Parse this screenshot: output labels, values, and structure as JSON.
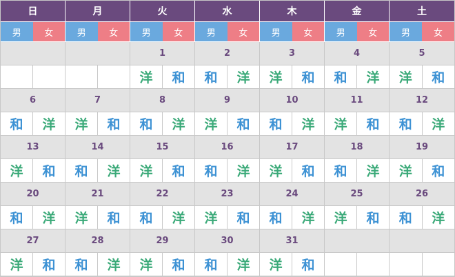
{
  "colors": {
    "header_bg": "#6a4a7e",
    "male": "#6aa9de",
    "female": "#ee7e86",
    "date_bg": "#e3e3e3",
    "date_text": "#6a4a7e",
    "wa": "#3d92d4",
    "yo": "#3aa978"
  },
  "weekdays": [
    "日",
    "月",
    "火",
    "水",
    "木",
    "金",
    "土"
  ],
  "gender_labels": {
    "male": "男",
    "female": "女"
  },
  "weeks": [
    {
      "days": [
        {
          "date": "",
          "marks": [
            "",
            ""
          ]
        },
        {
          "date": "",
          "marks": [
            "",
            ""
          ]
        },
        {
          "date": "1",
          "marks": [
            "洋",
            "和"
          ]
        },
        {
          "date": "2",
          "marks": [
            "和",
            "洋"
          ]
        },
        {
          "date": "3",
          "marks": [
            "洋",
            "和"
          ]
        },
        {
          "date": "4",
          "marks": [
            "和",
            "洋"
          ]
        },
        {
          "date": "5",
          "marks": [
            "洋",
            "和"
          ]
        }
      ]
    },
    {
      "days": [
        {
          "date": "6",
          "marks": [
            "和",
            "洋"
          ]
        },
        {
          "date": "7",
          "marks": [
            "洋",
            "和"
          ]
        },
        {
          "date": "8",
          "marks": [
            "和",
            "洋"
          ]
        },
        {
          "date": "9",
          "marks": [
            "洋",
            "和"
          ]
        },
        {
          "date": "10",
          "marks": [
            "和",
            "洋"
          ]
        },
        {
          "date": "11",
          "marks": [
            "洋",
            "和"
          ]
        },
        {
          "date": "12",
          "marks": [
            "和",
            "洋"
          ]
        }
      ]
    },
    {
      "days": [
        {
          "date": "13",
          "marks": [
            "洋",
            "和"
          ]
        },
        {
          "date": "14",
          "marks": [
            "和",
            "洋"
          ]
        },
        {
          "date": "15",
          "marks": [
            "洋",
            "和"
          ]
        },
        {
          "date": "16",
          "marks": [
            "和",
            "洋"
          ]
        },
        {
          "date": "17",
          "marks": [
            "洋",
            "和"
          ]
        },
        {
          "date": "18",
          "marks": [
            "和",
            "洋"
          ]
        },
        {
          "date": "19",
          "marks": [
            "洋",
            "和"
          ]
        }
      ]
    },
    {
      "days": [
        {
          "date": "20",
          "marks": [
            "和",
            "洋"
          ]
        },
        {
          "date": "21",
          "marks": [
            "洋",
            "和"
          ]
        },
        {
          "date": "22",
          "marks": [
            "和",
            "洋"
          ]
        },
        {
          "date": "23",
          "marks": [
            "洋",
            "和"
          ]
        },
        {
          "date": "24",
          "marks": [
            "和",
            "洋"
          ]
        },
        {
          "date": "25",
          "marks": [
            "洋",
            "和"
          ]
        },
        {
          "date": "26",
          "marks": [
            "和",
            "洋"
          ]
        }
      ]
    },
    {
      "days": [
        {
          "date": "27",
          "marks": [
            "洋",
            "和"
          ]
        },
        {
          "date": "28",
          "marks": [
            "和",
            "洋"
          ]
        },
        {
          "date": "29",
          "marks": [
            "洋",
            "和"
          ]
        },
        {
          "date": "30",
          "marks": [
            "和",
            "洋"
          ]
        },
        {
          "date": "31",
          "marks": [
            "洋",
            "和"
          ]
        },
        {
          "date": "",
          "marks": [
            "",
            ""
          ]
        },
        {
          "date": "",
          "marks": [
            "",
            ""
          ]
        }
      ]
    }
  ]
}
